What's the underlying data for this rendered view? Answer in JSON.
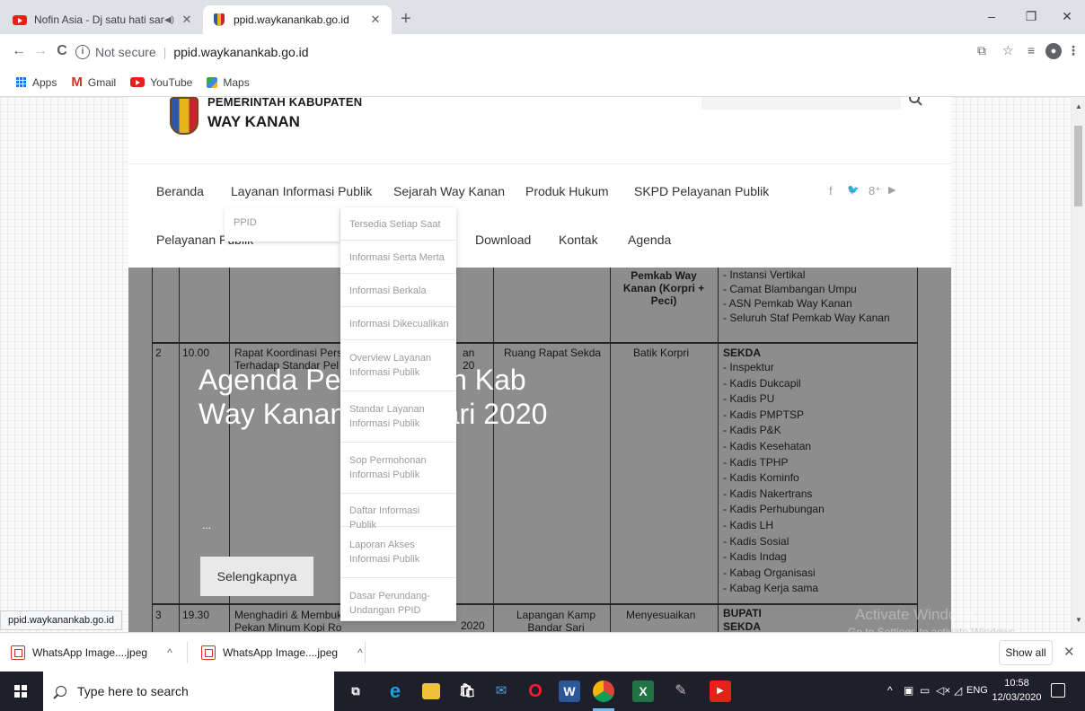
{
  "browser": {
    "tabs": [
      {
        "title": "Nofin Asia - Dj satu hati sam",
        "audio": "◀)",
        "active": false
      },
      {
        "title": "ppid.waykanankab.go.id",
        "active": true
      }
    ],
    "new_tab": "+",
    "window_controls": {
      "minimize": "–",
      "maximize": "❐",
      "close": "✕"
    },
    "nav": {
      "back": "←",
      "forward": "→",
      "reload": "C"
    },
    "address": {
      "security": "Not secure",
      "url": "ppid.waykanankab.go.id"
    },
    "bookmarks": [
      {
        "label": "Apps",
        "icon": "apps-grid-icon"
      },
      {
        "label": "Gmail",
        "icon": "gmail-icon"
      },
      {
        "label": "YouTube",
        "icon": "youtube-icon"
      },
      {
        "label": "Maps",
        "icon": "maps-icon"
      }
    ],
    "status_url": "ppid.waykanankab.go.id"
  },
  "site": {
    "title_line1": "PEMERINTAH KABUPATEN",
    "title_line2": "WAY KANAN",
    "nav_row1": [
      "Beranda",
      "Layanan Informasi Publik",
      "Sejarah Way Kanan",
      "Produk Hukum",
      "SKPD Pelayanan Publik"
    ],
    "nav_row2": [
      "Pelayanan Publik",
      "Download",
      "Kontak",
      "Agenda"
    ],
    "social": [
      "f",
      "🐦",
      "8⁺",
      "▶"
    ],
    "dropdown_level1": "PPID",
    "dropdown_level2": [
      "Tersedia Setiap Saat",
      "Informasi Serta Merta",
      "Informasi Berkala",
      "Informasi Dikecualikan",
      "Overview Layanan Informasi Publik",
      "Standar Layanan Informasi Publik",
      "Sop Permohonan Informasi Publik",
      "Daftar Informasi Publik",
      "Laporan Akses Informasi Publik",
      "Dasar Perundang-Undangan PPID"
    ],
    "slide": {
      "title": "Agenda Pem Daerah Kab Way Kanan. Seni uari 2020",
      "ellipsis": "...",
      "button": "Selengkapnya"
    },
    "doc": {
      "top_cell": "Pemkab Way Kanan (Korpri + Peci)",
      "top_list": [
        "- Instansi Vertikal",
        "- Camat Blambangan Umpu",
        "- ASN Pemkab Way Kanan",
        "- Seluruh Staf Pemkab Way Kanan"
      ],
      "row2": {
        "no": "2",
        "time": "10.00",
        "activity": "Rapat Koordinasi Pers Terhadap Standar Pel",
        "frag": "an 20",
        "place": "Ruang Rapat Sekda",
        "dress": "Batik Korpri",
        "attendees_head": "SEKDA",
        "attendees": [
          "- Inspektur",
          "- Kadis Dukcapil",
          "- Kadis PU",
          "- Kadis PMPTSP",
          "- Kadis P&K",
          "- Kadis Kesehatan",
          "- Kadis TPHP",
          "- Kadis Kominfo",
          "- Kadis Nakertrans",
          "- Kadis Perhubungan",
          "- Kadis LH",
          "- Kadis Sosial",
          "- Kadis Indag",
          "- Kabag Organisasi",
          "- Kabag Kerja sama"
        ]
      },
      "row3": {
        "no": "3",
        "time": "19.30",
        "activity": "Menghadiri & Membuk Pekan Minum Kopi Ro",
        "frag": "2020",
        "place": "Lapangan Kamp Bandar Sari",
        "dress": "Menyesuaikan",
        "attendees_head": "BUPATI",
        "attendees_head2": "SEKDA"
      }
    }
  },
  "windows_watermark": {
    "line1": "Activate Windows",
    "line2": "Go to Settings to activate Windows."
  },
  "downloads": {
    "items": [
      "WhatsApp Image....jpeg",
      "WhatsApp Image....jpeg"
    ],
    "chevron": "^",
    "show_all": "Show all",
    "close": "✕"
  },
  "taskbar": {
    "search_placeholder": "Type here to search",
    "tray_lang": "ENG",
    "time": "10:58",
    "date": "12/03/2020"
  },
  "colors": {
    "youtube": "#e62117",
    "taskbar": "#1f1f2b",
    "tabstrip": "#dee1e6"
  }
}
